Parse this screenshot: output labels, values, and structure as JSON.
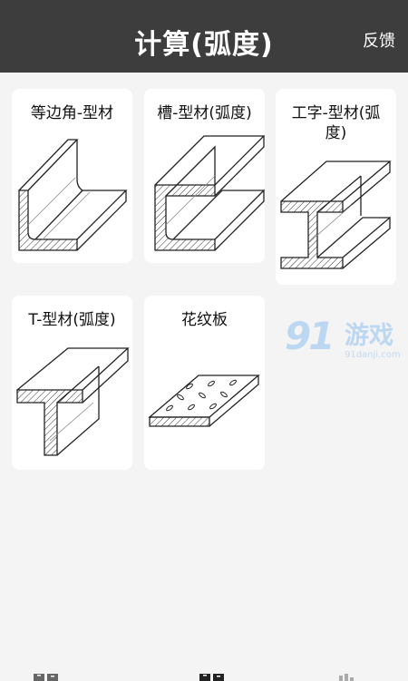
{
  "header": {
    "title": "计算(弧度)",
    "feedback": "反馈"
  },
  "cards": [
    {
      "label": "等边角-型材"
    },
    {
      "label": "槽-型材(弧度)"
    },
    {
      "label": "工字-型材(弧度)"
    },
    {
      "label": "T-型材(弧度)"
    },
    {
      "label": "花纹板"
    }
  ],
  "watermark": {
    "logo": "91",
    "brand": "游戏",
    "url": "91danji.com"
  },
  "colors": {
    "header_bg": "#3d3d3d",
    "page_bg": "#f4f4f4",
    "card_bg": "#ffffff"
  }
}
